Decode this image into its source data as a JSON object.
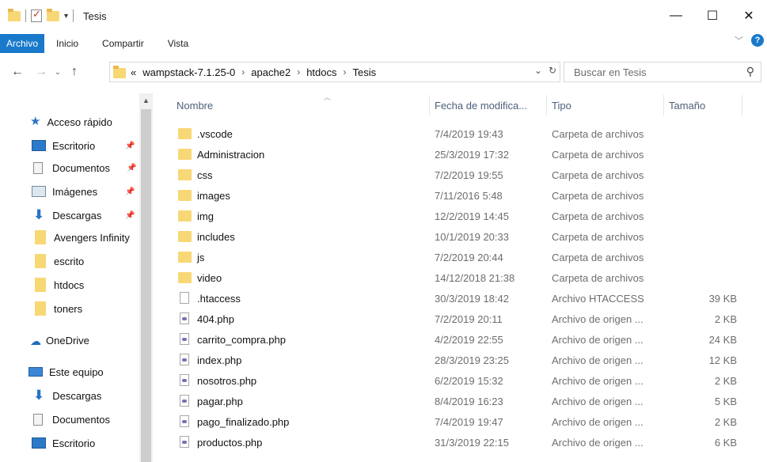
{
  "window": {
    "title": "Tesis",
    "minimize": "—",
    "maximize": "☐",
    "close": "✕"
  },
  "ribbon": {
    "tabs": [
      "Archivo",
      "Inicio",
      "Compartir",
      "Vista"
    ],
    "active_tab": "Archivo",
    "accent": "#1979ca"
  },
  "address": {
    "prefix": "«",
    "crumbs": [
      "wampstack-7.1.25-0",
      "apache2",
      "htdocs",
      "Tesis"
    ],
    "separator": "›"
  },
  "search": {
    "placeholder": "Buscar en Tesis"
  },
  "nav": {
    "quick_access": "Acceso rápido",
    "items": [
      {
        "label": "Escritorio",
        "icon": "desktop-icon",
        "pinned": true
      },
      {
        "label": "Documentos",
        "icon": "document-icon",
        "pinned": true
      },
      {
        "label": "Imágenes",
        "icon": "pictures-icon",
        "pinned": true
      },
      {
        "label": "Descargas",
        "icon": "download-icon",
        "pinned": true
      },
      {
        "label": "Avengers Infinity",
        "icon": "folder-icon",
        "pinned": false
      },
      {
        "label": "escrito",
        "icon": "folder-icon",
        "pinned": false
      },
      {
        "label": "htdocs",
        "icon": "folder-icon",
        "pinned": false
      },
      {
        "label": "toners",
        "icon": "folder-icon",
        "pinned": false
      }
    ],
    "onedrive": "OneDrive",
    "this_pc": "Este equipo",
    "pc_items": [
      {
        "label": "Descargas",
        "icon": "download-icon"
      },
      {
        "label": "Documentos",
        "icon": "document-icon"
      },
      {
        "label": "Escritorio",
        "icon": "desktop-icon"
      }
    ]
  },
  "columns": {
    "name": "Nombre",
    "date": "Fecha de modifica...",
    "type": "Tipo",
    "size": "Tamaño"
  },
  "files": [
    {
      "name": ".vscode",
      "date": "7/4/2019 19:43",
      "type": "Carpeta de archivos",
      "size": "",
      "kind": "folder"
    },
    {
      "name": "Administracion",
      "date": "25/3/2019 17:32",
      "type": "Carpeta de archivos",
      "size": "",
      "kind": "folder"
    },
    {
      "name": "css",
      "date": "7/2/2019 19:55",
      "type": "Carpeta de archivos",
      "size": "",
      "kind": "folder"
    },
    {
      "name": "images",
      "date": "7/11/2016 5:48",
      "type": "Carpeta de archivos",
      "size": "",
      "kind": "folder"
    },
    {
      "name": "img",
      "date": "12/2/2019 14:45",
      "type": "Carpeta de archivos",
      "size": "",
      "kind": "folder"
    },
    {
      "name": "includes",
      "date": "10/1/2019 20:33",
      "type": "Carpeta de archivos",
      "size": "",
      "kind": "folder"
    },
    {
      "name": "js",
      "date": "7/2/2019 20:44",
      "type": "Carpeta de archivos",
      "size": "",
      "kind": "folder"
    },
    {
      "name": "video",
      "date": "14/12/2018 21:38",
      "type": "Carpeta de archivos",
      "size": "",
      "kind": "folder"
    },
    {
      "name": ".htaccess",
      "date": "30/3/2019 18:42",
      "type": "Archivo HTACCESS",
      "size": "39 KB",
      "kind": "file"
    },
    {
      "name": "404.php",
      "date": "7/2/2019 20:11",
      "type": "Archivo de origen ...",
      "size": "2 KB",
      "kind": "php"
    },
    {
      "name": "carrito_compra.php",
      "date": "4/2/2019 22:55",
      "type": "Archivo de origen ...",
      "size": "24 KB",
      "kind": "php"
    },
    {
      "name": "index.php",
      "date": "28/3/2019 23:25",
      "type": "Archivo de origen ...",
      "size": "12 KB",
      "kind": "php"
    },
    {
      "name": "nosotros.php",
      "date": "6/2/2019 15:32",
      "type": "Archivo de origen ...",
      "size": "2 KB",
      "kind": "php"
    },
    {
      "name": "pagar.php",
      "date": "8/4/2019 16:23",
      "type": "Archivo de origen ...",
      "size": "5 KB",
      "kind": "php"
    },
    {
      "name": "pago_finalizado.php",
      "date": "7/4/2019 19:47",
      "type": "Archivo de origen ...",
      "size": "2 KB",
      "kind": "php"
    },
    {
      "name": "productos.php",
      "date": "31/3/2019 22:15",
      "type": "Archivo de origen ...",
      "size": "6 KB",
      "kind": "php"
    }
  ]
}
